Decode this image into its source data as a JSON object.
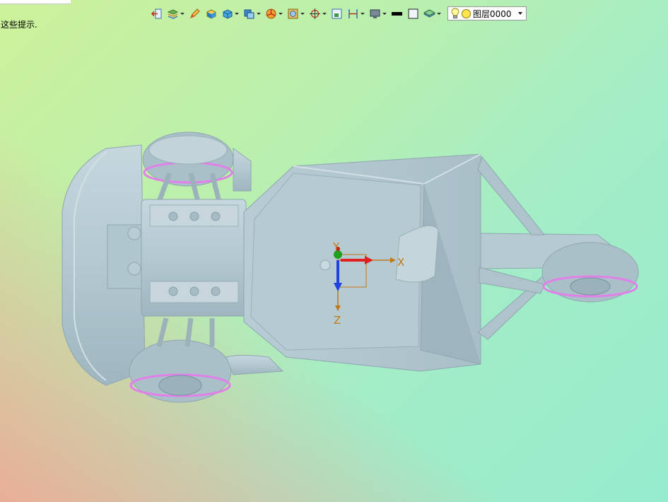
{
  "hint_text": "这些提示.",
  "layer": {
    "current_value": "图层0000"
  },
  "axes": {
    "x_label": "X",
    "y_label": "Y",
    "z_label": "Z"
  },
  "colors": {
    "model_fill": "#b6cbd3",
    "model_edge": "#8fa6b0",
    "rim_highlight": "#e080e8",
    "axis_x": "#e02020",
    "axis_y": "#20a020",
    "axis_z": "#2040e0",
    "axis_label": "#c07a18"
  },
  "toolbar": {
    "icons": [
      "exit-sketch-icon",
      "layers-icon",
      "pencil-icon",
      "shaded-box-icon",
      "solid-box-icon",
      "view-cube-icon",
      "pie-render-icon",
      "texture-icon",
      "center-target-icon",
      "frame-icon",
      "dimension-icon",
      "monitor-icon",
      "line-color-icon",
      "fill-square-icon",
      "layer-stack-icon"
    ]
  }
}
